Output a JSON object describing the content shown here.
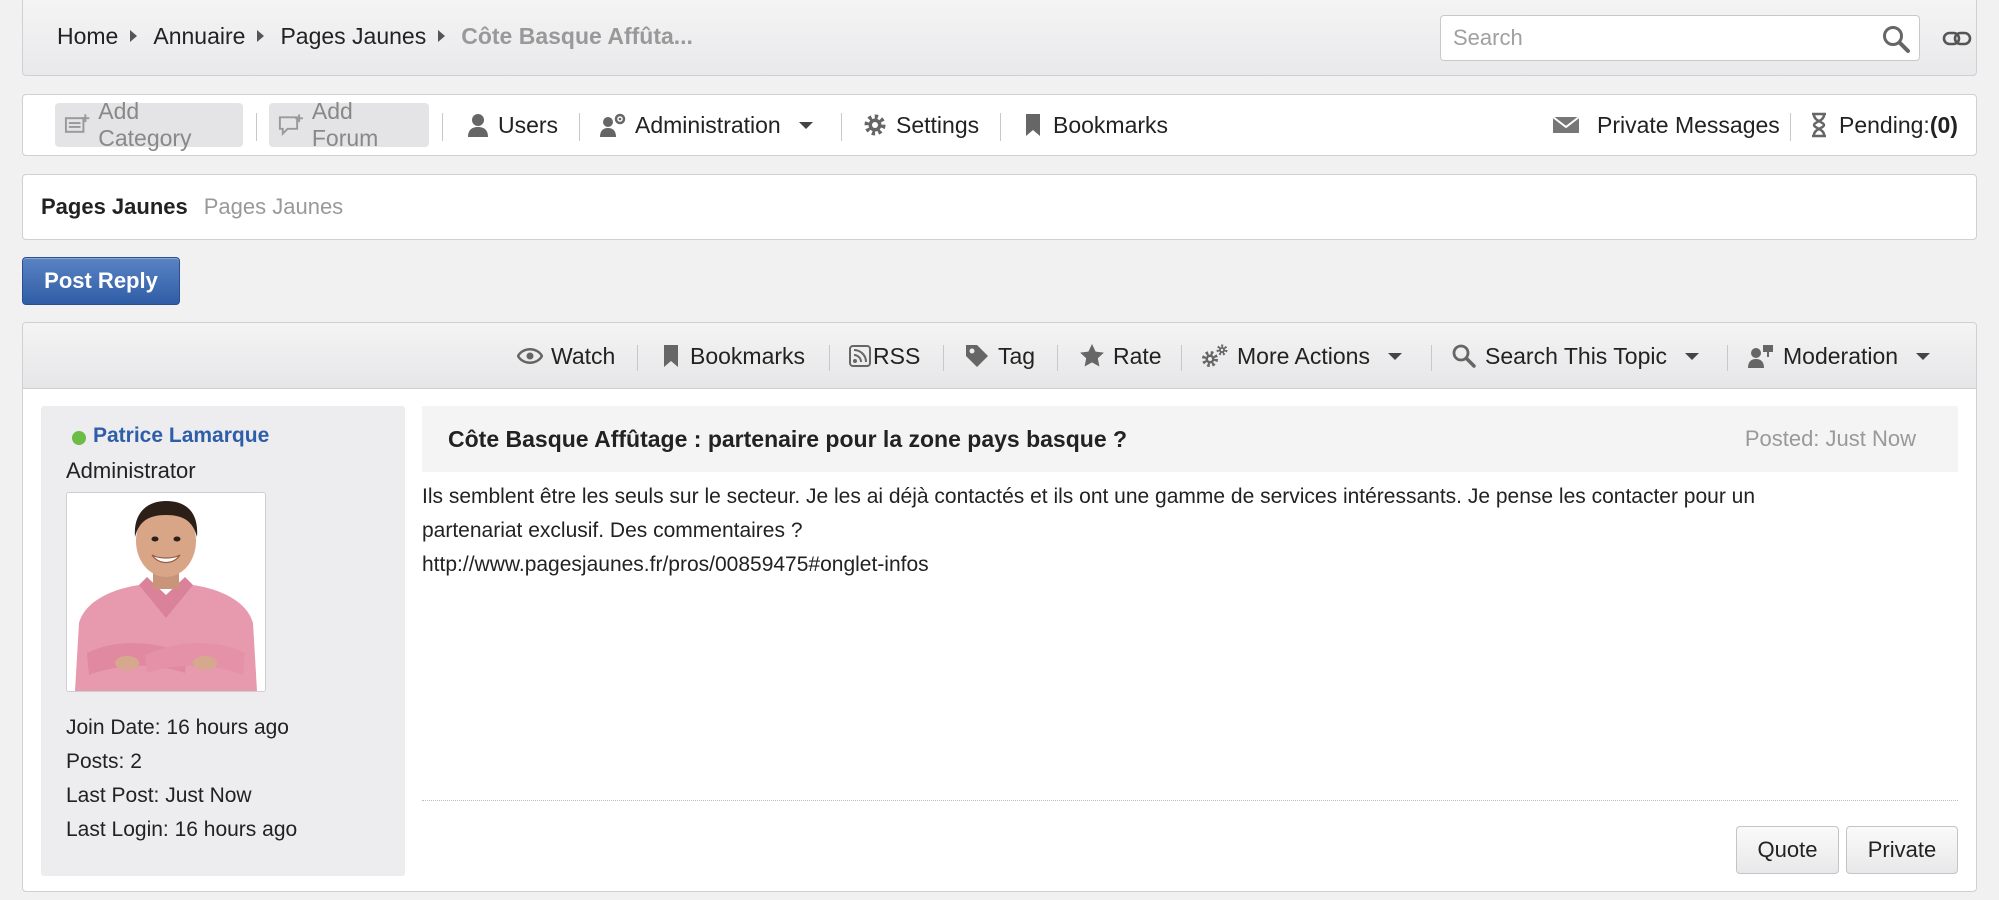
{
  "breadcrumb": {
    "items": [
      "Home",
      "Annuaire",
      "Pages Jaunes"
    ],
    "current": "Côte Basque Affûta..."
  },
  "search": {
    "placeholder": "Search"
  },
  "toolbar": {
    "add_category": "Add Category",
    "add_forum": "Add Forum",
    "users": "Users",
    "administration": "Administration",
    "settings": "Settings",
    "bookmarks": "Bookmarks",
    "private_messages": "Private Messages",
    "pending_label": "Pending:",
    "pending_count": "(0)"
  },
  "forum": {
    "title": "Pages Jaunes",
    "description": "Pages Jaunes"
  },
  "post_reply_label": "Post Reply",
  "topic_actions": {
    "watch": "Watch",
    "bookmarks": "Bookmarks",
    "rss": "RSS",
    "tag": "Tag",
    "rate": "Rate",
    "more_actions": "More Actions",
    "search_topic": "Search This Topic",
    "moderation": "Moderation"
  },
  "author": {
    "name": "Patrice Lamarque",
    "role": "Administrator",
    "status_color": "#6cbd45",
    "join_date": "Join Date: 16 hours ago",
    "posts": "Posts: 2",
    "last_post": "Last Post: Just Now",
    "last_login": "Last Login: 16 hours ago"
  },
  "post": {
    "title": "Côte Basque Affûtage : partenaire pour la zone pays basque ?",
    "posted": "Posted: Just Now",
    "body_line1": "Ils semblent être les seuls sur le secteur. Je les ai déjà contactés et ils ont une gamme de services intéressants. Je pense les contacter pour un",
    "body_line2": "partenariat exclusif. Des commentaires ?",
    "body_link": "http://www.pagesjaunes.fr/pros/00859475#onglet-infos",
    "quote_label": "Quote",
    "private_label": "Private"
  },
  "colors": {
    "accent": "#2f5ea8",
    "button_primary": "#3a66ad",
    "muted_text": "#999999"
  }
}
